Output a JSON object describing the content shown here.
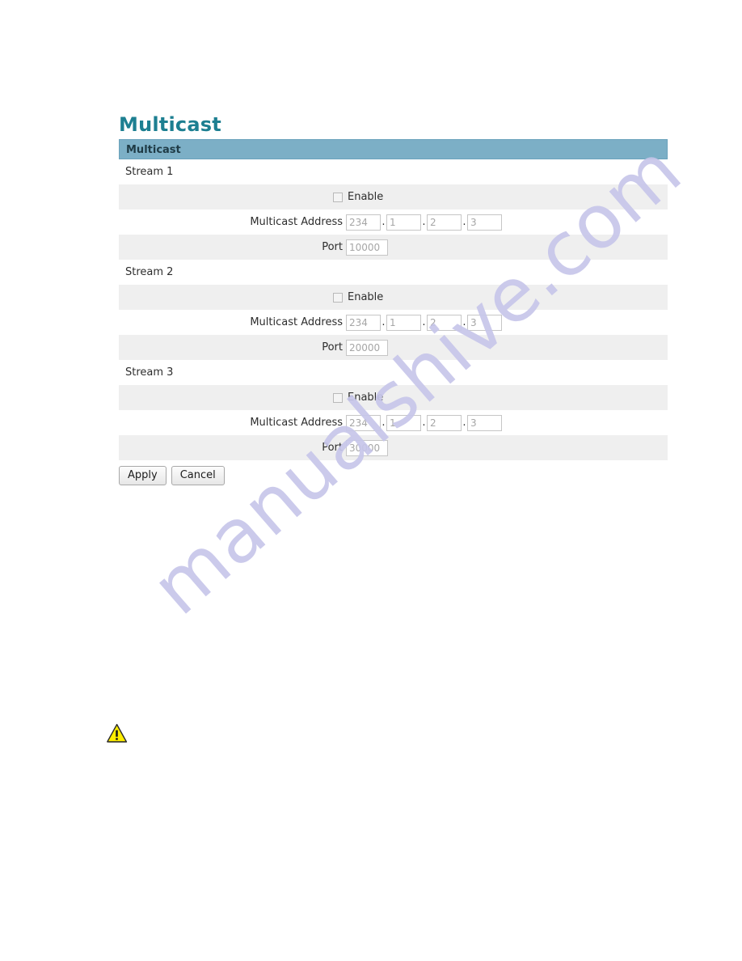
{
  "page": {
    "title": "Multicast",
    "panel_header": "Multicast"
  },
  "watermark": {
    "text": "manualshive.com",
    "color": "#c7c6ea"
  },
  "colors": {
    "title": "#1d7f91",
    "panel_header_bg": "#7cafc6",
    "row_alt_bg": "#efefef",
    "row_plain_bg": "#ffffff",
    "input_text": "#a6a6a6",
    "warning_yellow": "#ffee00"
  },
  "labels": {
    "enable": "Enable",
    "multicast_address": "Multicast Address",
    "port": "Port",
    "dot": "."
  },
  "streams": [
    {
      "name": "Stream 1",
      "enable_label": "Enable",
      "enable_checked": false,
      "address_label": "Multicast Address",
      "address": [
        "234",
        "1",
        "2",
        "3"
      ],
      "port_label": "Port",
      "port": "10000"
    },
    {
      "name": "Stream 2",
      "enable_label": "Enable",
      "enable_checked": false,
      "address_label": "Multicast Address",
      "address": [
        "234",
        "1",
        "2",
        "3"
      ],
      "port_label": "Port",
      "port": "20000"
    },
    {
      "name": "Stream 3",
      "enable_label": "Enable",
      "enable_checked": false,
      "address_label": "Multicast Address",
      "address": [
        "234",
        "1",
        "2",
        "3"
      ],
      "port_label": "Port",
      "port": "30000"
    }
  ],
  "buttons": {
    "apply": "Apply",
    "cancel": "Cancel"
  },
  "icons": {
    "warning": "warning-triangle-icon"
  }
}
